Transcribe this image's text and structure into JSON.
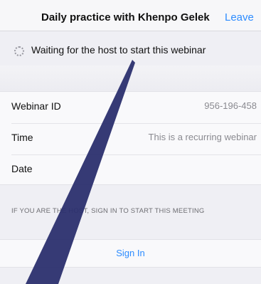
{
  "navbar": {
    "title": "Daily practice with Khenpo Gelek",
    "leave_label": "Leave"
  },
  "status": {
    "waiting_text": "Waiting for the host to start this webinar",
    "spinner_icon": "loading-spinner-icon"
  },
  "details": {
    "rows": [
      {
        "label": "Webinar ID",
        "value": "956-196-458"
      },
      {
        "label": "Time",
        "value": "This is a recurring webinar"
      },
      {
        "label": "Date",
        "value": ""
      }
    ]
  },
  "host_note": "IF YOU ARE THE HOST, SIGN IN TO START THIS MEETING",
  "signin": {
    "label": "Sign In"
  },
  "colors": {
    "accent": "#2d8cff",
    "arrow": "#2b2f6e"
  }
}
